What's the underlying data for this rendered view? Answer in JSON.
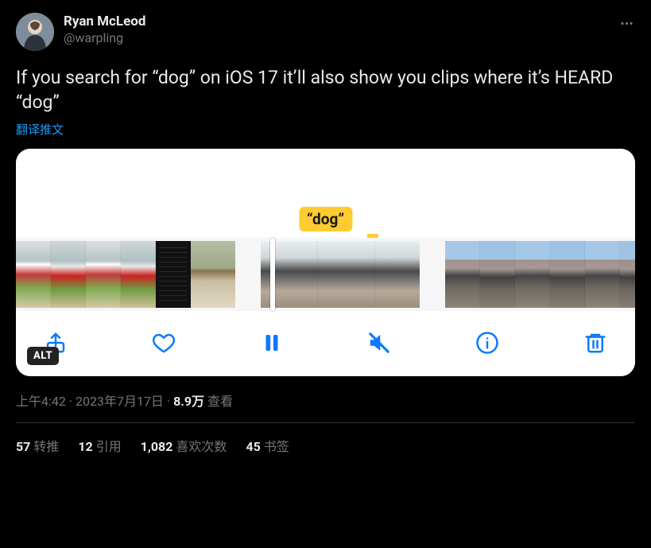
{
  "author": {
    "name": "Ryan McLeod",
    "handle": "@warpling"
  },
  "tweet_text": "If you search for “dog” on iOS 17 it’ll also show you clips where it’s HEARD “dog”",
  "translate_link": "翻译推文",
  "media": {
    "chip_text": "“dog”",
    "alt_badge": "ALT"
  },
  "meta": {
    "time": "上午4:42",
    "date": "2023年7月17日",
    "views_value": "8.9万",
    "views_label": "查看",
    "separator": " · "
  },
  "stats": {
    "retweets": {
      "count": "57",
      "label": "转推"
    },
    "quotes": {
      "count": "12",
      "label": "引用"
    },
    "likes": {
      "count": "1,082",
      "label": "喜欢次数"
    },
    "bookmarks": {
      "count": "45",
      "label": "书签"
    }
  }
}
